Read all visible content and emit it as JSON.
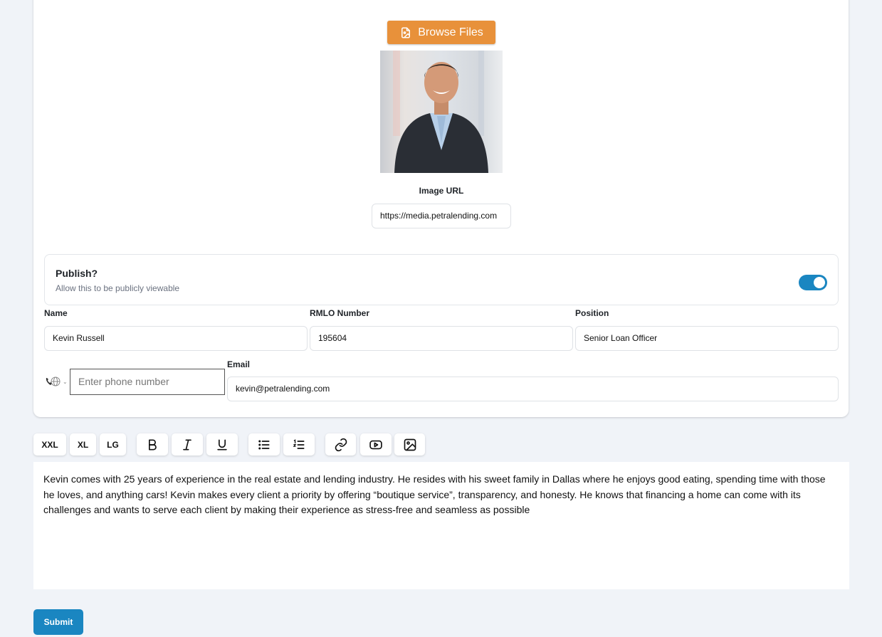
{
  "upload": {
    "browse_label": "Browse Files"
  },
  "image": {
    "url_label": "Image URL",
    "url_value": "https://media.petralending.com"
  },
  "publish": {
    "title": "Publish?",
    "subtitle": "Allow this to be publicly viewable",
    "enabled": true
  },
  "fields": {
    "name_label": "Name",
    "name_value": "Kevin Russell",
    "rmlo_label": "RMLO Number",
    "rmlo_value": "195604",
    "position_label": "Position",
    "position_value": "Senior Loan Officer",
    "phone_placeholder": "Enter phone number",
    "email_label": "Email",
    "email_value": "kevin@petralending.com"
  },
  "toolbar": {
    "xxl": "XXL",
    "xl": "XL",
    "lg": "LG",
    "icons": [
      "bold-icon",
      "italic-icon",
      "underline-icon",
      "bullet-list-icon",
      "numbered-list-icon",
      "link-icon",
      "youtube-icon",
      "image-icon"
    ]
  },
  "editor": {
    "content": "Kevin comes with 25 years of experience in the real estate and lending industry. He resides with his sweet family in Dallas where he enjoys good eating, spending time with those he loves, and anything cars! Kevin makes every client a priority by offering “boutique service”, transparency, and honesty. He knows that financing a home can come with its challenges and wants to serve each client by making their experience as stress-free and seamless as possible"
  },
  "submit_label": "Submit",
  "colors": {
    "accent_orange": "#e8913a",
    "accent_blue": "#1a86c1",
    "page_bg": "#f0f3f8"
  }
}
